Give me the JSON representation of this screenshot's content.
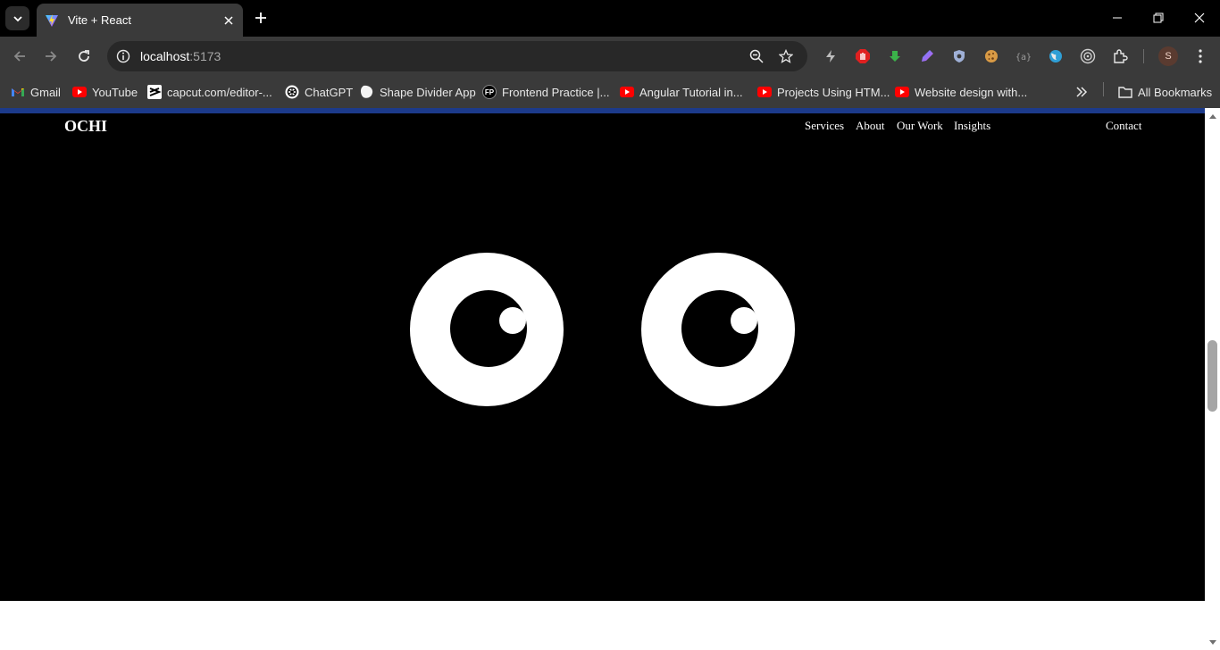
{
  "browser": {
    "tab": {
      "title": "Vite + React"
    },
    "omnibox": {
      "url_host": "localhost",
      "url_port": ":5173"
    },
    "profile_initial": "S",
    "bookmarks": [
      {
        "label": "Gmail",
        "icon": "gmail-icon"
      },
      {
        "label": "YouTube",
        "icon": "youtube-icon"
      },
      {
        "label": "capcut.com/editor-...",
        "icon": "capcut-icon"
      },
      {
        "label": "ChatGPT",
        "icon": "chatgpt-icon"
      },
      {
        "label": "Shape Divider App",
        "icon": "shape-divider-icon"
      },
      {
        "label": "Frontend Practice |...",
        "icon": "fp-icon"
      },
      {
        "label": "Angular Tutorial in...",
        "icon": "youtube-icon"
      },
      {
        "label": "Projects Using HTM...",
        "icon": "youtube-icon"
      },
      {
        "label": "Website design with...",
        "icon": "youtube-icon"
      }
    ],
    "all_bookmarks": "All Bookmarks",
    "fp_badge": "FP"
  },
  "page": {
    "logo": "OCHI",
    "nav": [
      {
        "label": "Services"
      },
      {
        "label": "About"
      },
      {
        "label": "Our Work"
      },
      {
        "label": "Insights"
      }
    ],
    "contact": "Contact",
    "colors": {
      "background": "#000000",
      "eye": "#ffffff",
      "accent_bar": "#1c3a8a"
    }
  }
}
